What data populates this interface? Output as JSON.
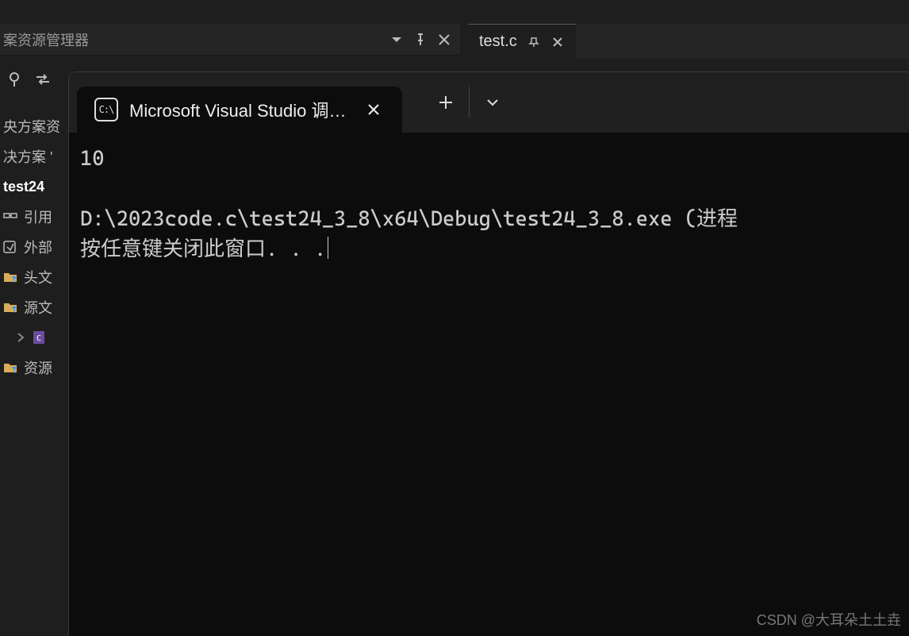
{
  "panel": {
    "title": "案资源管理器"
  },
  "editor": {
    "tab_label": "test.c"
  },
  "tree": {
    "solution_line": "央方案资",
    "solution_prefix": "决方案 '",
    "project": "test24",
    "refs": "引用",
    "external": "外部",
    "headers": "头文",
    "sources": "源文",
    "resources": "资源"
  },
  "terminal": {
    "tab_title": "Microsoft Visual Studio 调试控",
    "icon_text": "C:\\",
    "output_line1": "10",
    "output_line2": "D:\\2023code.c\\test24_3_8\\x64\\Debug\\test24_3_8.exe (进程",
    "output_line3": "按任意键关闭此窗口. . .",
    "add_icon": "+",
    "dropdown_icon": "⌄"
  },
  "watermark": "CSDN @大耳朵土土垚"
}
